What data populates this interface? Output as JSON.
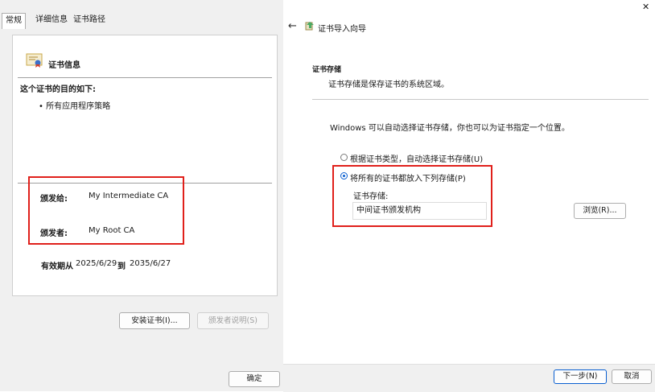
{
  "left_dialog": {
    "tabs": [
      {
        "label": "常规"
      },
      {
        "label": "详细信息"
      },
      {
        "label": "证书路径"
      }
    ],
    "cert_title": "证书信息",
    "purpose_heading": "这个证书的目的如下:",
    "purpose_item": "• 所有应用程序策略",
    "issued_to_label": "颁发给:",
    "issued_to_value": "My Intermediate CA",
    "issued_by_label": "颁发者:",
    "issued_by_value": "My Root CA",
    "validity_label": "有效期从",
    "valid_from": "2025/6/29",
    "validity_to": "到",
    "valid_to": "2035/6/27",
    "install_button": "安装证书(I)...",
    "issuer_statement_button": "颁发者说明(S)",
    "ok_button": "确定"
  },
  "wizard": {
    "title": "证书导入向导",
    "close_glyph": "✕",
    "section_title": "证书存储",
    "section_desc": "证书存储是保存证书的系统区域。",
    "intro": "Windows 可以自动选择证书存储，你也可以为证书指定一个位置。",
    "option_auto": "根据证书类型，自动选择证书存储(U)",
    "option_manual": "将所有的证书都放入下列存储(P)",
    "selected_option": "manual",
    "store_label": "证书存储:",
    "store_value": "中间证书颁发机构",
    "browse_button": "浏览(R)...",
    "next_button": "下一步(N)",
    "cancel_button": "取消"
  },
  "colors": {
    "highlight": "#e0201b",
    "radio_selected": "#0a5fd0"
  }
}
